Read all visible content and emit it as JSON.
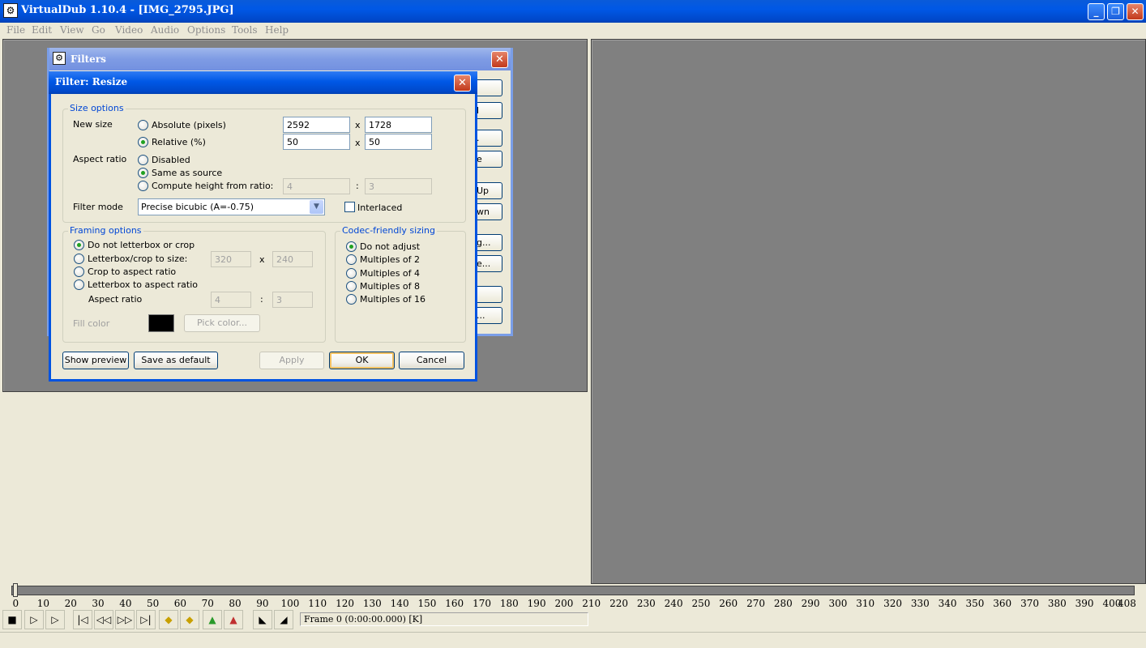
{
  "app": {
    "title": "VirtualDub 1.10.4 - [IMG_2795.JPG]",
    "icon": "film-gear-icon",
    "window_controls": [
      "_",
      "❐",
      "✕"
    ]
  },
  "menu": [
    "File",
    "Edit",
    "View",
    "Go",
    "Video",
    "Audio",
    "Options",
    "Tools",
    "Help"
  ],
  "filters_window": {
    "title": "Filters",
    "side_buttons": [
      "",
      "l",
      ".",
      "e",
      "Up",
      "wn",
      "g...",
      "e...",
      "",
      "..."
    ]
  },
  "resize_dialog": {
    "title": "Filter: Resize",
    "size_options": {
      "legend": "Size options",
      "new_size_label": "New size",
      "absolute_label": "Absolute (pixels)",
      "abs_width": "2592",
      "abs_x": "x",
      "abs_height": "1728",
      "relative_label": "Relative (%)",
      "rel_width": "50",
      "rel_x": "x",
      "rel_height": "50",
      "aspect_ratio_label": "Aspect ratio",
      "disabled_label": "Disabled",
      "same_as_source_label": "Same as source",
      "compute_height_label": "Compute height from ratio:",
      "ratio_a": "4",
      "ratio_sep": ":",
      "ratio_b": "3",
      "filter_mode_label": "Filter mode",
      "filter_mode_value": "Precise bicubic (A=-0.75)",
      "interlaced_label": "Interlaced"
    },
    "framing_options": {
      "legend": "Framing options",
      "no_letterbox_label": "Do not letterbox or crop",
      "letterbox_crop_label": "Letterbox/crop to size:",
      "lb_width": "320",
      "lb_x": "x",
      "lb_height": "240",
      "crop_aspect_label": "Crop to aspect ratio",
      "letterbox_aspect_label": "Letterbox to aspect ratio",
      "aspect_ratio_label": "Aspect ratio",
      "ar_a": "4",
      "ar_sep": ":",
      "ar_b": "3",
      "fill_color_label": "Fill color",
      "fill_color": "#000000",
      "pick_color_label": "Pick color..."
    },
    "codec_sizing": {
      "legend": "Codec-friendly sizing",
      "options": [
        "Do not adjust",
        "Multiples of 2",
        "Multiples of 4",
        "Multiples of 8",
        "Multiples of 16"
      ]
    },
    "buttons": {
      "show_preview": "Show preview",
      "save_default": "Save as default",
      "apply": "Apply",
      "ok": "OK",
      "cancel": "Cancel"
    }
  },
  "timeline": {
    "ticks": [
      "0",
      "10",
      "20",
      "30",
      "40",
      "50",
      "60",
      "70",
      "80",
      "90",
      "100",
      "110",
      "120",
      "130",
      "140",
      "150",
      "160",
      "170",
      "180",
      "190",
      "200",
      "210",
      "220",
      "230",
      "240",
      "250",
      "260",
      "270",
      "280",
      "290",
      "300",
      "310",
      "320",
      "330",
      "340",
      "350",
      "360",
      "370",
      "380",
      "390",
      "400",
      "408"
    ],
    "frame_status": "Frame 0 (0:00:00.000) [K]"
  }
}
